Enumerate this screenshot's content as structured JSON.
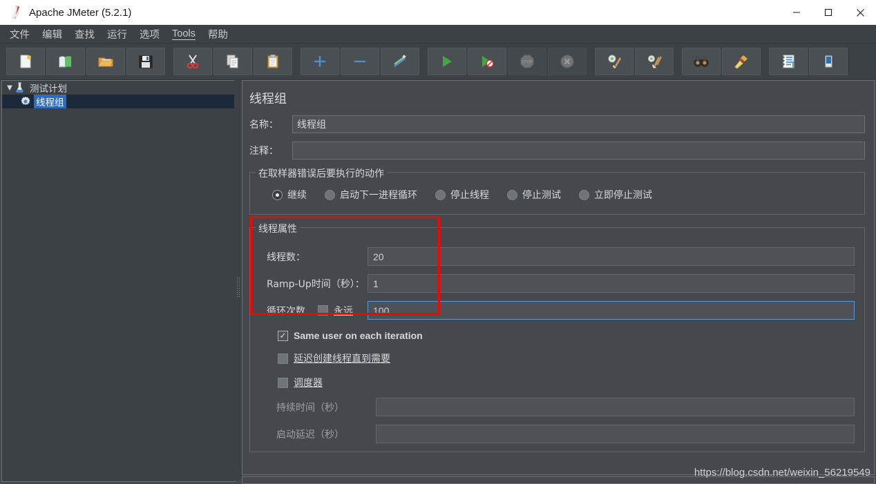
{
  "window": {
    "title": "Apache JMeter (5.2.1)",
    "app_icon": "jmeter-flask-icon",
    "controls": {
      "minimize": "–",
      "maximize": "□",
      "close": "✕"
    }
  },
  "menubar": {
    "items": [
      {
        "label": "文件",
        "name": "menu-file"
      },
      {
        "label": "编辑",
        "name": "menu-edit"
      },
      {
        "label": "查找",
        "name": "menu-search"
      },
      {
        "label": "运行",
        "name": "menu-run"
      },
      {
        "label": "选项",
        "name": "menu-options"
      },
      {
        "label": "Tools",
        "name": "menu-tools"
      },
      {
        "label": "帮助",
        "name": "menu-help"
      }
    ]
  },
  "toolbar": {
    "buttons": [
      {
        "icon": "new-file-icon",
        "name": "toolbar-new"
      },
      {
        "icon": "templates-icon",
        "name": "toolbar-templates"
      },
      {
        "icon": "open-folder-icon",
        "name": "toolbar-open"
      },
      {
        "icon": "save-icon",
        "name": "toolbar-save"
      },
      {
        "icon": "cut-scissors-icon",
        "name": "toolbar-cut"
      },
      {
        "icon": "copy-icon",
        "name": "toolbar-copy"
      },
      {
        "icon": "paste-clipboard-icon",
        "name": "toolbar-paste"
      },
      {
        "icon": "plus-icon",
        "name": "toolbar-expand"
      },
      {
        "icon": "minus-icon",
        "name": "toolbar-collapse"
      },
      {
        "icon": "toggle-pencil-icon",
        "name": "toolbar-toggle"
      },
      {
        "icon": "start-play-icon",
        "name": "toolbar-start"
      },
      {
        "icon": "start-no-pauses-icon",
        "name": "toolbar-start-no-pauses"
      },
      {
        "icon": "stop-icon",
        "name": "toolbar-stop"
      },
      {
        "icon": "shutdown-icon",
        "name": "toolbar-shutdown"
      },
      {
        "icon": "clear-gear-broom-icon",
        "name": "toolbar-clear"
      },
      {
        "icon": "clear-all-broom-icon",
        "name": "toolbar-clear-all"
      },
      {
        "icon": "search-binoculars-icon",
        "name": "toolbar-search"
      },
      {
        "icon": "reset-search-broom-icon",
        "name": "toolbar-reset-search"
      },
      {
        "icon": "log-viewer-icon",
        "name": "toolbar-log-viewer"
      },
      {
        "icon": "partial-edge-icon",
        "name": "toolbar-overflow"
      }
    ]
  },
  "tree": {
    "nodes": [
      {
        "label": "测试计划",
        "icon": "test-plan-flask-icon",
        "expanded": true,
        "selected": false
      },
      {
        "label": "线程组",
        "icon": "thread-group-gear-icon",
        "expanded": false,
        "selected": true
      }
    ]
  },
  "editor": {
    "title": "线程组",
    "name_label": "名称：",
    "name_value": "线程组",
    "comments_label": "注释：",
    "comments_value": "",
    "error_action": {
      "legend": "在取样器错误后要执行的动作",
      "options": [
        {
          "label": "继续",
          "selected": true
        },
        {
          "label": "启动下一进程循环",
          "selected": false
        },
        {
          "label": "停止线程",
          "selected": false
        },
        {
          "label": "停止测试",
          "selected": false
        },
        {
          "label": "立即停止测试",
          "selected": false
        }
      ]
    },
    "thread_props": {
      "legend": "线程属性",
      "threads_label": "线程数：",
      "threads_value": "20",
      "rampup_label": "Ramp-Up时间（秒）：",
      "rampup_value": "1",
      "loops_label": "循环次数",
      "forever_label": "永远",
      "forever_checked": false,
      "loops_value": "100",
      "loops_focused": true,
      "same_user_label": "Same user on each iteration",
      "same_user_checked": true,
      "delay_create_label": "延迟创建线程直到需要",
      "delay_create_checked": false,
      "scheduler_label": "调度器",
      "scheduler_checked": false,
      "duration_label": "持续时间（秒）",
      "duration_value": "",
      "startup_delay_label": "启动延迟（秒）",
      "startup_delay_value": ""
    }
  },
  "annotation": {
    "name": "red-highlight-box",
    "color": "#ff0000"
  },
  "watermark": {
    "text": "https://blog.csdn.net/weixin_56219549"
  }
}
